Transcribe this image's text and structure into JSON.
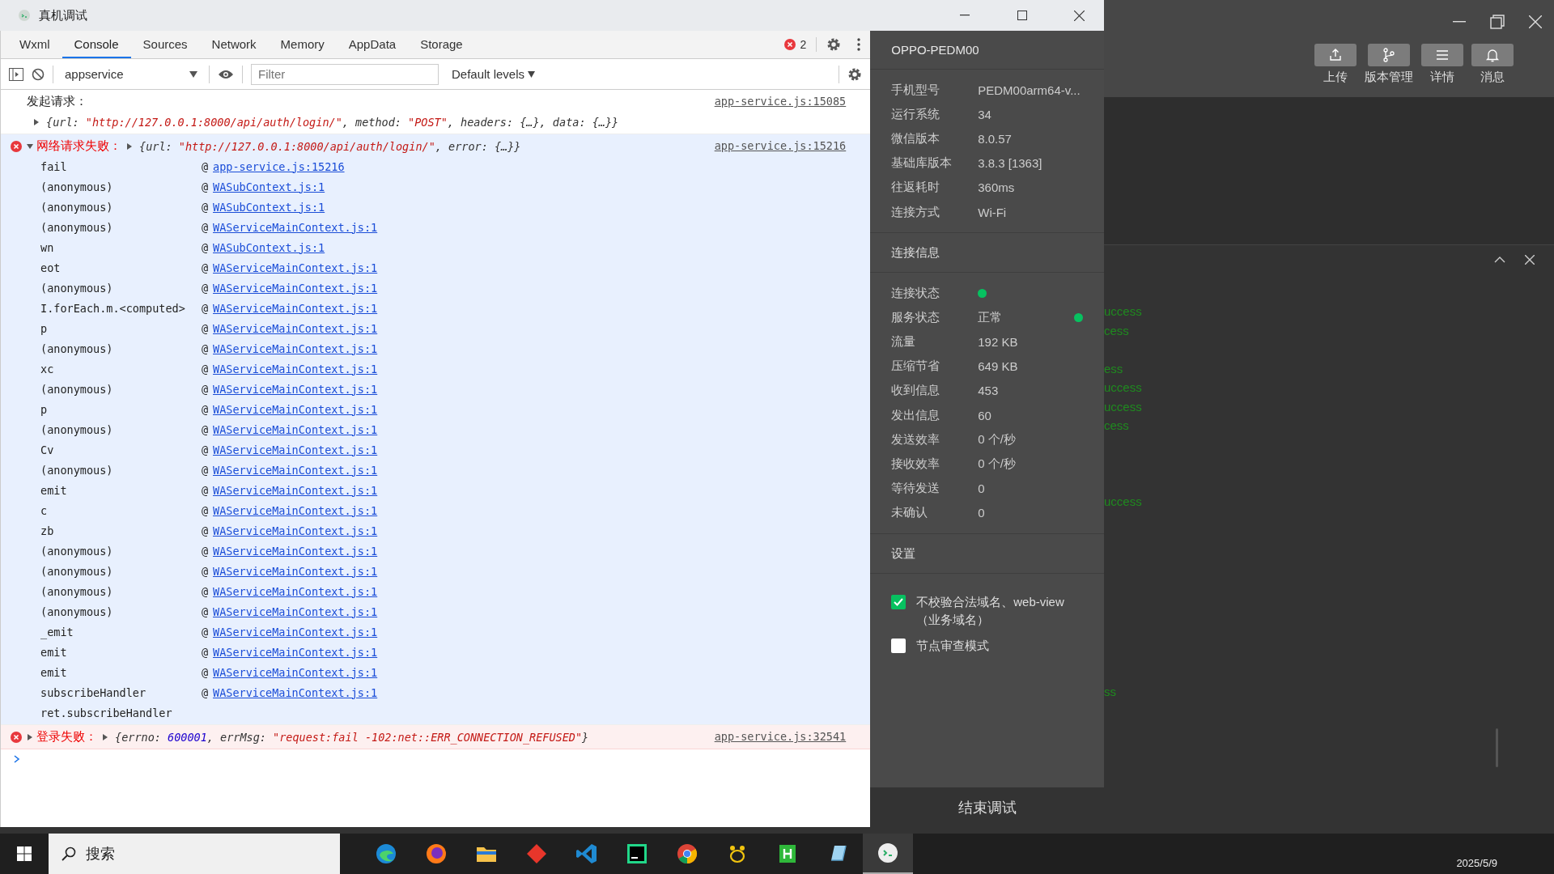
{
  "window": {
    "title": "真机调试"
  },
  "tabs": [
    {
      "label": "Wxml",
      "selected": false
    },
    {
      "label": "Console",
      "selected": true
    },
    {
      "label": "Sources",
      "selected": false
    },
    {
      "label": "Network",
      "selected": false
    },
    {
      "label": "Memory",
      "selected": false
    },
    {
      "label": "AppData",
      "selected": false
    },
    {
      "label": "Storage",
      "selected": false
    }
  ],
  "error_count": "2",
  "toolbar": {
    "context": "appservice",
    "filter_placeholder": "Filter",
    "levels": "Default levels"
  },
  "console": [
    {
      "kind": "log",
      "highlighted": false,
      "expanded": false,
      "message": "发起请求：",
      "tokens": [
        {
          "kind": "plain",
          "text": "{url: "
        },
        {
          "kind": "string",
          "text": "\"http://127.0.0.1:8000/api/auth/login/\""
        },
        {
          "kind": "plain",
          "text": ", method: "
        },
        {
          "kind": "string",
          "text": "\"POST\""
        },
        {
          "kind": "plain",
          "text": ", headers: {…}, data: {…}}"
        }
      ],
      "source": "app-service.js:15085"
    },
    {
      "kind": "error",
      "highlighted": true,
      "expanded": true,
      "message": "网络请求失败：",
      "tokens": [
        {
          "kind": "plain",
          "text": "{url: "
        },
        {
          "kind": "string",
          "text": "\"http://127.0.0.1:8000/api/auth/login/\""
        },
        {
          "kind": "plain",
          "text": ", error: {…}}"
        }
      ],
      "source": "app-service.js:15216",
      "stack": [
        {
          "fn": "fail",
          "at": "@",
          "link": "app-service.js:15216"
        },
        {
          "fn": "(anonymous)",
          "at": "@",
          "link": "WASubContext.js:1"
        },
        {
          "fn": "(anonymous)",
          "at": "@",
          "link": "WASubContext.js:1"
        },
        {
          "fn": "(anonymous)",
          "at": "@",
          "link": "WAServiceMainContext.js:1"
        },
        {
          "fn": "wn",
          "at": "@",
          "link": "WASubContext.js:1"
        },
        {
          "fn": "eot",
          "at": "@",
          "link": "WAServiceMainContext.js:1"
        },
        {
          "fn": "(anonymous)",
          "at": "@",
          "link": "WAServiceMainContext.js:1"
        },
        {
          "fn": "I.forEach.m.<computed>",
          "at": "@",
          "link": "WAServiceMainContext.js:1"
        },
        {
          "fn": "p",
          "at": "@",
          "link": "WAServiceMainContext.js:1"
        },
        {
          "fn": "(anonymous)",
          "at": "@",
          "link": "WAServiceMainContext.js:1"
        },
        {
          "fn": "xc",
          "at": "@",
          "link": "WAServiceMainContext.js:1"
        },
        {
          "fn": "(anonymous)",
          "at": "@",
          "link": "WAServiceMainContext.js:1"
        },
        {
          "fn": "p",
          "at": "@",
          "link": "WAServiceMainContext.js:1"
        },
        {
          "fn": "(anonymous)",
          "at": "@",
          "link": "WAServiceMainContext.js:1"
        },
        {
          "fn": "Cv",
          "at": "@",
          "link": "WAServiceMainContext.js:1"
        },
        {
          "fn": "(anonymous)",
          "at": "@",
          "link": "WAServiceMainContext.js:1"
        },
        {
          "fn": "emit",
          "at": "@",
          "link": "WAServiceMainContext.js:1"
        },
        {
          "fn": "c",
          "at": "@",
          "link": "WAServiceMainContext.js:1"
        },
        {
          "fn": "zb",
          "at": "@",
          "link": "WAServiceMainContext.js:1"
        },
        {
          "fn": "(anonymous)",
          "at": "@",
          "link": "WAServiceMainContext.js:1"
        },
        {
          "fn": "(anonymous)",
          "at": "@",
          "link": "WAServiceMainContext.js:1"
        },
        {
          "fn": "(anonymous)",
          "at": "@",
          "link": "WAServiceMainContext.js:1"
        },
        {
          "fn": "(anonymous)",
          "at": "@",
          "link": "WAServiceMainContext.js:1"
        },
        {
          "fn": "_emit",
          "at": "@",
          "link": "WAServiceMainContext.js:1"
        },
        {
          "fn": "emit",
          "at": "@",
          "link": "WAServiceMainContext.js:1"
        },
        {
          "fn": "emit",
          "at": "@",
          "link": "WAServiceMainContext.js:1"
        },
        {
          "fn": "subscribeHandler",
          "at": "@",
          "link": "WAServiceMainContext.js:1"
        },
        {
          "fn": "ret.subscribeHandler"
        }
      ]
    },
    {
      "kind": "error",
      "highlighted": false,
      "expanded": false,
      "message": "登录失败：",
      "tokens": [
        {
          "kind": "plain",
          "text": "{errno: "
        },
        {
          "kind": "number",
          "text": "600001"
        },
        {
          "kind": "plain",
          "text": ", errMsg: "
        },
        {
          "kind": "string",
          "text": "\"request:fail -102:net::ERR_CONNECTION_REFUSED\""
        },
        {
          "kind": "plain",
          "text": "}"
        }
      ],
      "source": "app-service.js:32541"
    }
  ],
  "device": {
    "name": "OPPO-PEDM00",
    "info": [
      {
        "label": "手机型号",
        "value": "PEDM00arm64-v..."
      },
      {
        "label": "运行系统",
        "value": "34"
      },
      {
        "label": "微信版本",
        "value": "8.0.57"
      },
      {
        "label": "基础库版本",
        "value": "3.8.3 [1363]"
      },
      {
        "label": "往返耗时",
        "value": "360ms"
      },
      {
        "label": "连接方式",
        "value": "Wi-Fi"
      }
    ],
    "connection_title": "连接信息",
    "connection": [
      {
        "label": "连接状态",
        "status": true
      },
      {
        "label": "服务状态",
        "value": "正常",
        "status": true
      },
      {
        "label": "流量",
        "value": "192 KB"
      },
      {
        "label": "压缩节省",
        "value": "649 KB"
      },
      {
        "label": "收到信息",
        "value": "453"
      },
      {
        "label": "发出信息",
        "value": "60"
      },
      {
        "label": "发送效率",
        "value": "0 个/秒"
      },
      {
        "label": "接收效率",
        "value": "0 个/秒"
      },
      {
        "label": "等待发送",
        "value": "0"
      },
      {
        "label": "未确认",
        "value": "0"
      }
    ],
    "settings_title": "设置",
    "settings": [
      {
        "label": "不校验合法域名、web-view（业务域名）",
        "checked": true
      },
      {
        "label": "节点审查模式",
        "checked": false
      }
    ],
    "end_button": "结束调试"
  },
  "ide": {
    "actions": [
      {
        "kind": "upload",
        "label": "上传"
      },
      {
        "kind": "branch",
        "label": "版本管理"
      },
      {
        "kind": "list",
        "label": "详情"
      },
      {
        "kind": "bell",
        "label": "消息"
      }
    ],
    "log_fragments": [
      {
        "kind": "text",
        "text": "uccess"
      },
      {
        "kind": "text",
        "text": "cess"
      },
      {
        "kind": "blank"
      },
      {
        "kind": "text",
        "text": "ess"
      },
      {
        "kind": "text",
        "text": "uccess"
      },
      {
        "kind": "text",
        "text": "uccess"
      },
      {
        "kind": "text",
        "text": "cess"
      },
      {
        "kind": "blank"
      },
      {
        "kind": "blank"
      },
      {
        "kind": "blank"
      },
      {
        "kind": "text",
        "text": "uccess"
      },
      {
        "kind": "blank"
      },
      {
        "kind": "blank"
      },
      {
        "kind": "blank"
      },
      {
        "kind": "blank"
      },
      {
        "kind": "blank"
      },
      {
        "kind": "blank"
      },
      {
        "kind": "blank"
      },
      {
        "kind": "blank"
      },
      {
        "kind": "blank"
      },
      {
        "kind": "text",
        "text": "ss"
      }
    ]
  },
  "taskbar": {
    "search": "搜索",
    "apps": [
      {
        "kind": "edge",
        "selected": false
      },
      {
        "kind": "firefox",
        "selected": false
      },
      {
        "kind": "folder",
        "selected": false
      },
      {
        "kind": "diamond",
        "selected": false
      },
      {
        "kind": "vscode",
        "selected": false
      },
      {
        "kind": "pycharm",
        "selected": false
      },
      {
        "kind": "chrome",
        "selected": false
      },
      {
        "kind": "paw",
        "selected": false
      },
      {
        "kind": "hbuilder",
        "selected": false
      },
      {
        "kind": "notepad",
        "selected": false
      },
      {
        "kind": "wechat-dev",
        "selected": true
      }
    ],
    "date": "2025/5/9"
  }
}
